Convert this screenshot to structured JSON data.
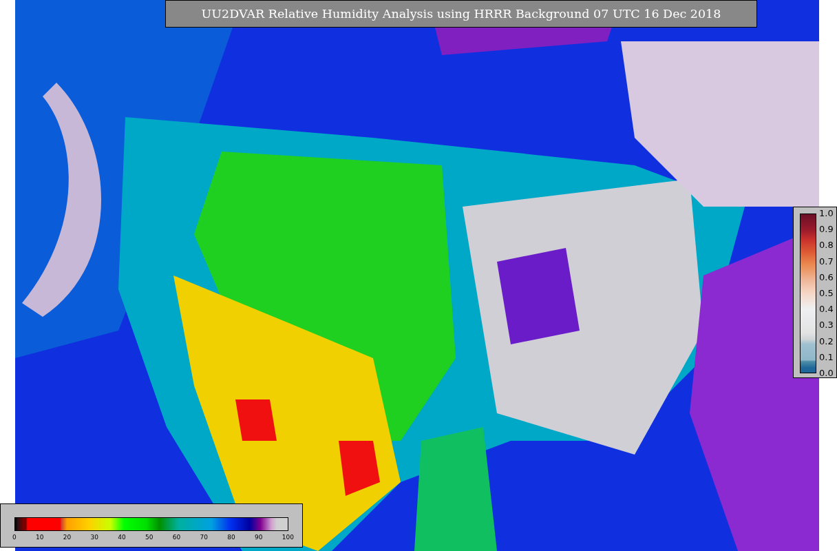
{
  "title": "UU2DVAR Relative Humidity Analysis using HRRR Background 07 UTC 16 Dec 2018",
  "error_colorbar": {
    "ticks": [
      "1.0",
      "0.9",
      "0.8",
      "0.7",
      "0.6",
      "0.5",
      "0.4",
      "0.3",
      "0.2",
      "0.1",
      "0.0"
    ]
  },
  "humidity_colorbar": {
    "ticks": [
      "0",
      "10",
      "20",
      "30",
      "40",
      "50",
      "60",
      "70",
      "80",
      "90",
      "100"
    ]
  }
}
